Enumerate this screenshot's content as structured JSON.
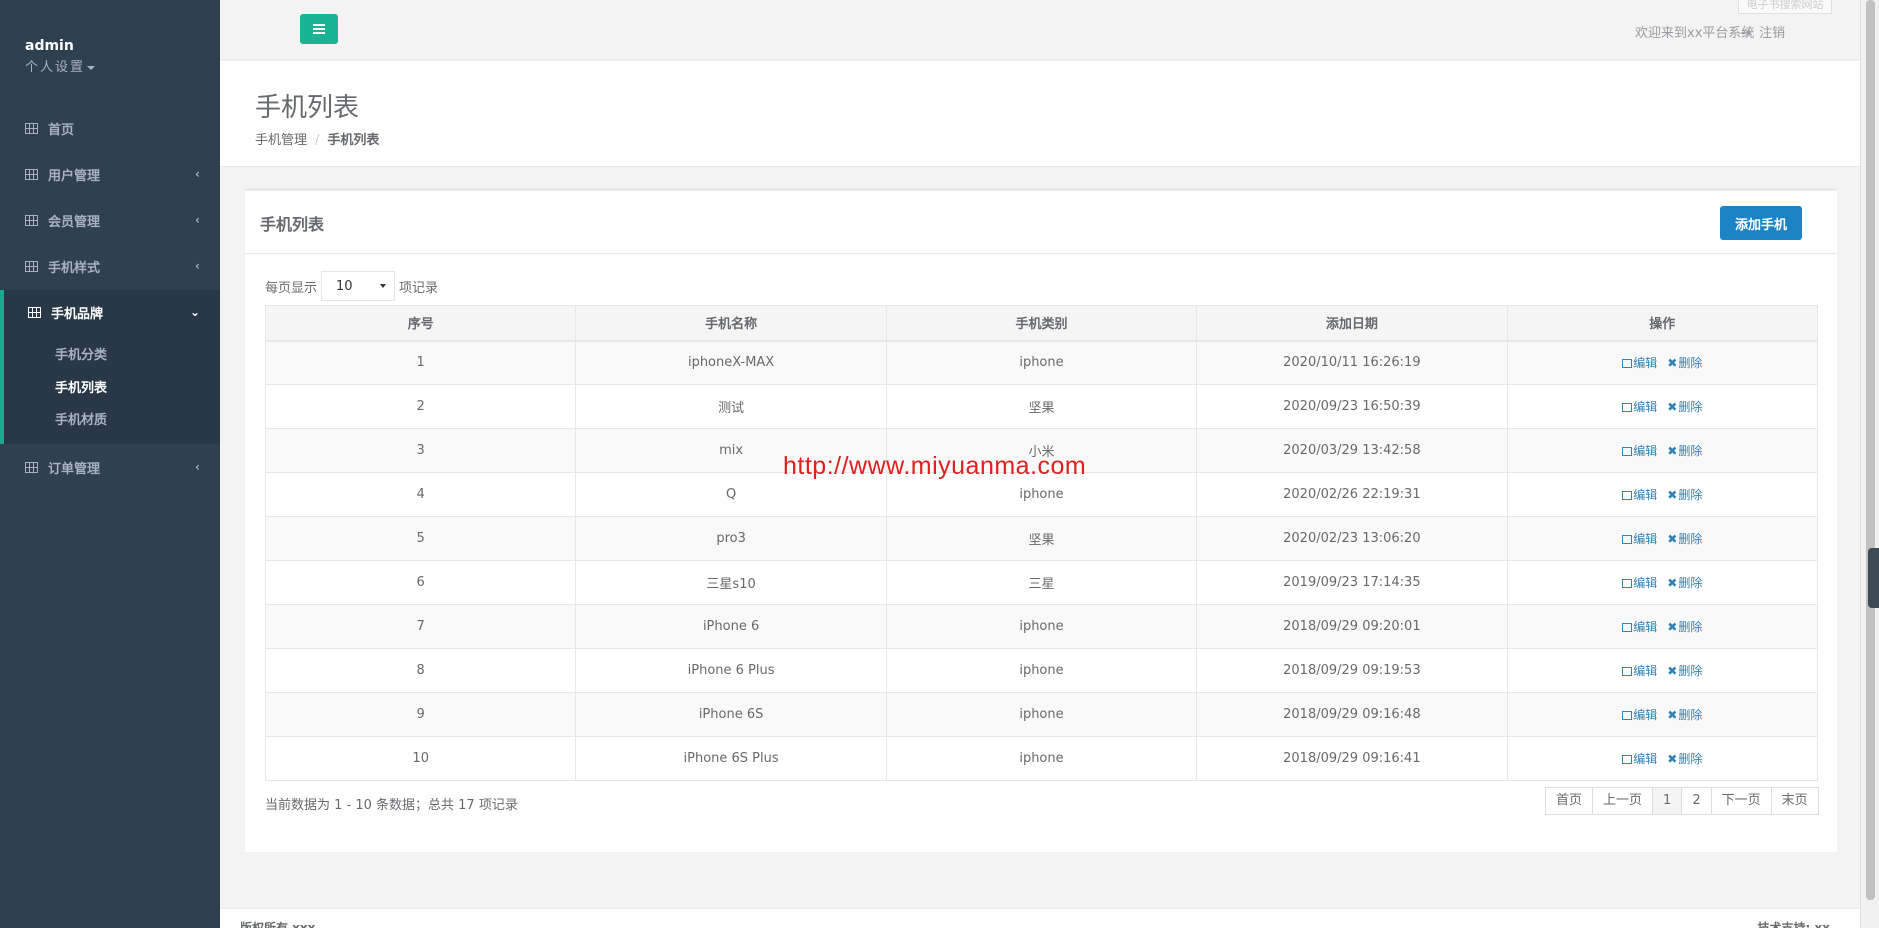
{
  "sidebar": {
    "user": "admin",
    "settings": "个人设置",
    "items": [
      {
        "label": "首页",
        "has_children": false
      },
      {
        "label": "用户管理",
        "has_children": true
      },
      {
        "label": "会员管理",
        "has_children": true
      },
      {
        "label": "手机样式",
        "has_children": true
      },
      {
        "label": "手机品牌",
        "has_children": true,
        "expanded": true
      },
      {
        "label": "订单管理",
        "has_children": true
      }
    ],
    "sub_items": [
      {
        "label": "手机分类"
      },
      {
        "label": "手机列表",
        "current": true
      },
      {
        "label": "手机材质"
      }
    ]
  },
  "topbar": {
    "welcome": "欢迎来到xx平台系统",
    "logout": "注销",
    "ghost": "电子书搜索网站"
  },
  "page": {
    "title": "手机列表",
    "breadcrumb": [
      "手机管理",
      "手机列表"
    ]
  },
  "panel": {
    "title": "手机列表",
    "add_button": "添加手机",
    "length_prefix": "每页显示",
    "length_value": "10",
    "length_suffix": "项记录",
    "columns": [
      "序号",
      "手机名称",
      "手机类别",
      "添加日期",
      "操作"
    ],
    "edit_label": "编辑",
    "delete_label": "删除",
    "rows": [
      {
        "id": "1",
        "name": "iphoneX-MAX",
        "category": "iphone",
        "date": "2020/10/11 16:26:19"
      },
      {
        "id": "2",
        "name": "测试",
        "category": "坚果",
        "date": "2020/09/23 16:50:39"
      },
      {
        "id": "3",
        "name": "mix",
        "category": "小米",
        "date": "2020/03/29 13:42:58"
      },
      {
        "id": "4",
        "name": "Q",
        "category": "iphone",
        "date": "2020/02/26 22:19:31"
      },
      {
        "id": "5",
        "name": "pro3",
        "category": "坚果",
        "date": "2020/02/23 13:06:20"
      },
      {
        "id": "6",
        "name": "三星s10",
        "category": "三星",
        "date": "2019/09/23 17:14:35"
      },
      {
        "id": "7",
        "name": "iPhone 6",
        "category": "iphone",
        "date": "2018/09/29 09:20:01"
      },
      {
        "id": "8",
        "name": "iPhone 6 Plus",
        "category": "iphone",
        "date": "2018/09/29 09:19:53"
      },
      {
        "id": "9",
        "name": "iPhone 6S",
        "category": "iphone",
        "date": "2018/09/29 09:16:48"
      },
      {
        "id": "10",
        "name": "iPhone 6S Plus",
        "category": "iphone",
        "date": "2018/09/29 09:16:41"
      }
    ],
    "info": "当前数据为 1 - 10 条数据；总共 17 项记录",
    "pager": [
      "首页",
      "上一页",
      "1",
      "2",
      "下一页",
      "末页"
    ],
    "pager_active": "1"
  },
  "footer": {
    "left": "版权所有 xxx",
    "right": "技术支持: xx"
  },
  "watermark": "http://www.miyuanma.com",
  "colors": {
    "sidebar_bg": "#2f4050",
    "accent_green": "#1ab394",
    "primary_blue": "#1c84c6",
    "link_blue": "#3182b6",
    "watermark_red": "#e02020"
  }
}
